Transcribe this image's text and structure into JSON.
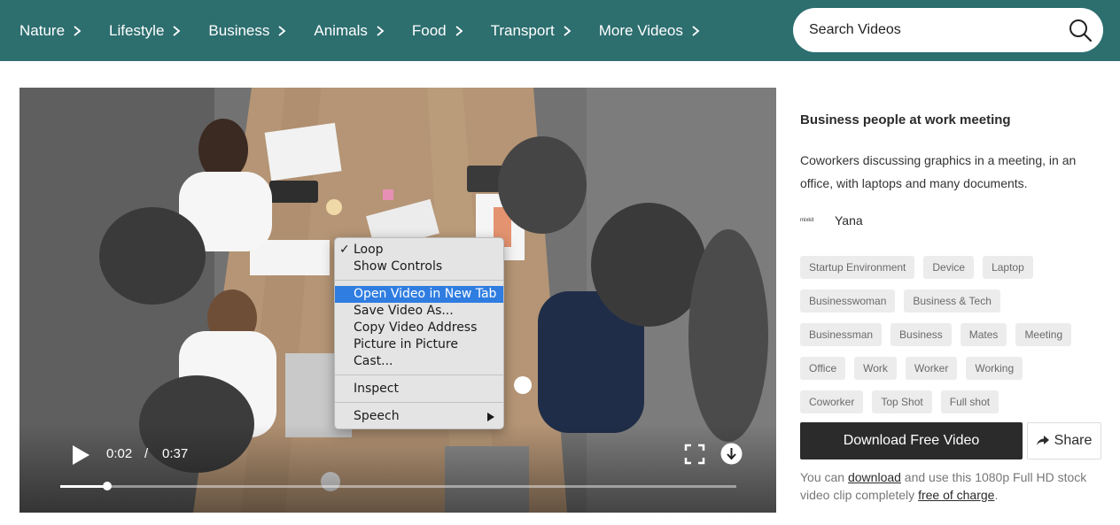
{
  "nav": {
    "items": [
      {
        "label": "Nature"
      },
      {
        "label": "Lifestyle"
      },
      {
        "label": "Business"
      },
      {
        "label": "Animals"
      },
      {
        "label": "Food"
      },
      {
        "label": "Transport"
      },
      {
        "label": "More Videos"
      }
    ],
    "search": {
      "placeholder": "Search Videos",
      "icon": "search-icon"
    },
    "background": "#2d6e6f"
  },
  "player": {
    "current_time": "0:02",
    "separator": "/",
    "duration": "0:37",
    "progress_fraction": 0.07,
    "buffered_fraction": 0.4
  },
  "context_menu": {
    "loop": {
      "check": "✓",
      "label": "Loop"
    },
    "show_controls": "Show Controls",
    "open_new_tab": "Open Video in New Tab",
    "save_as": "Save Video As...",
    "copy_address": "Copy Video Address",
    "pip": "Picture in Picture",
    "cast": "Cast...",
    "inspect": "Inspect",
    "speech": "Speech",
    "highlight_color": "#2f7de1"
  },
  "details": {
    "title": "Business people at work meeting",
    "description": "Coworkers discussing graphics in a meeting, in an office, with laptops and many documents.",
    "author": {
      "logo_text": "mixkit",
      "name": "Yana"
    },
    "tags": [
      [
        "Startup Environment",
        "Device",
        "Laptop"
      ],
      [
        "Businesswoman",
        "Business & Tech"
      ],
      [
        "Businessman",
        "Business",
        "Mates",
        "Meeting"
      ],
      [
        "Office",
        "Work",
        "Worker",
        "Working"
      ],
      [
        "Coworker",
        "Top Shot",
        "Full shot"
      ]
    ],
    "download_label": "Download Free Video",
    "share_label": "Share",
    "license": {
      "prefix": "You can ",
      "download_link": "download",
      "middle": " and use this 1080p Full HD stock video clip completely ",
      "free_link": "free of charge",
      "suffix": "."
    }
  }
}
